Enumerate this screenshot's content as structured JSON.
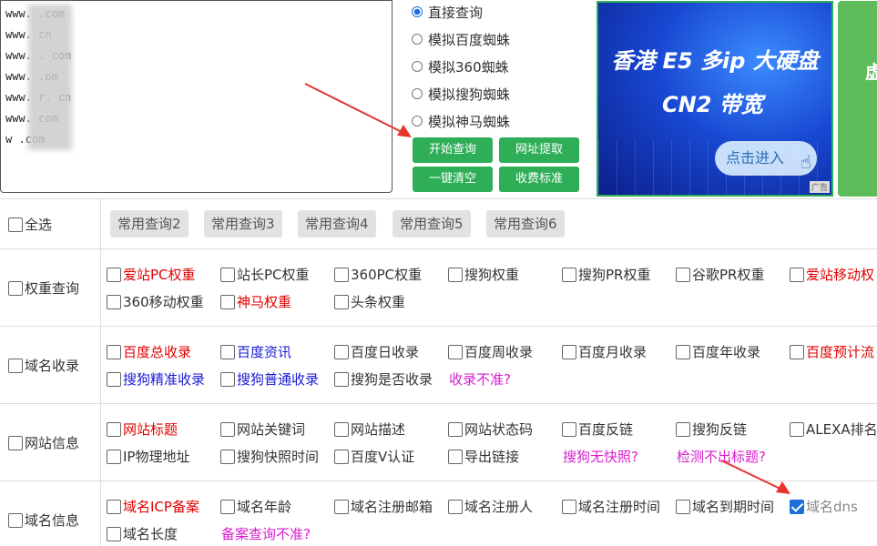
{
  "domains": [
    "www.        .com",
    "www.        cn",
    "www.        . com",
    "www.        .om",
    "www.        r. cn",
    "www.        com",
    "w         .com"
  ],
  "radios": [
    {
      "label": "直接查询",
      "checked": true
    },
    {
      "label": "模拟百度蜘蛛",
      "checked": false
    },
    {
      "label": "模拟360蜘蛛",
      "checked": false
    },
    {
      "label": "模拟搜狗蜘蛛",
      "checked": false
    },
    {
      "label": "模拟神马蜘蛛",
      "checked": false
    }
  ],
  "buttons": {
    "start": "开始查询",
    "extract": "网址提取",
    "clear": "一键清空",
    "pricing": "收费标准"
  },
  "ad": {
    "line1": "香港 E5 多ip  大硬盘",
    "line2": "CN2  带宽",
    "cta": "点击进入",
    "tag": "广告",
    "side_text": "虚"
  },
  "select_all": "全选",
  "common_queries": [
    "常用查询2",
    "常用查询3",
    "常用查询4",
    "常用查询5",
    "常用查询6"
  ],
  "sections": [
    {
      "label": "权重查询",
      "options": [
        {
          "label": "爱站PC权重",
          "color": "red"
        },
        {
          "label": "站长PC权重",
          "color": "dark"
        },
        {
          "label": "360PC权重",
          "color": "dark"
        },
        {
          "label": "搜狗权重",
          "color": "dark"
        },
        {
          "label": "搜狗PR权重",
          "color": "dark"
        },
        {
          "label": "谷歌PR权重",
          "color": "dark"
        },
        {
          "label": "爱站移动权",
          "color": "red"
        },
        {
          "label": "360移动权重",
          "color": "dark"
        },
        {
          "label": "神马权重",
          "color": "red"
        },
        {
          "label": "头条权重",
          "color": "dark"
        }
      ]
    },
    {
      "label": "域名收录",
      "options": [
        {
          "label": "百度总收录",
          "color": "red"
        },
        {
          "label": "百度资讯",
          "color": "blue"
        },
        {
          "label": "百度日收录",
          "color": "dark"
        },
        {
          "label": "百度周收录",
          "color": "dark"
        },
        {
          "label": "百度月收录",
          "color": "dark"
        },
        {
          "label": "百度年收录",
          "color": "dark"
        },
        {
          "label": "百度预计流",
          "color": "red"
        },
        {
          "label": "搜狗精准收录",
          "color": "blue"
        },
        {
          "label": "搜狗普通收录",
          "color": "blue"
        },
        {
          "label": "搜狗是否收录",
          "color": "dark"
        }
      ],
      "note": "收录不准?"
    },
    {
      "label": "网站信息",
      "options": [
        {
          "label": "网站标题",
          "color": "red"
        },
        {
          "label": "网站关键词",
          "color": "dark"
        },
        {
          "label": "网站描述",
          "color": "dark"
        },
        {
          "label": "网站状态码",
          "color": "dark"
        },
        {
          "label": "百度反链",
          "color": "dark"
        },
        {
          "label": "搜狗反链",
          "color": "dark"
        },
        {
          "label": "ALEXA排名",
          "color": "dark"
        },
        {
          "label": "IP物理地址",
          "color": "dark"
        },
        {
          "label": "搜狗快照时间",
          "color": "dark"
        },
        {
          "label": "百度V认证",
          "color": "dark"
        },
        {
          "label": "导出链接",
          "color": "dark"
        }
      ],
      "notes": [
        "搜狗无快照?",
        "检测不出标题?"
      ]
    },
    {
      "label": "域名信息",
      "options": [
        {
          "label": "域名ICP备案",
          "color": "red"
        },
        {
          "label": "域名年龄",
          "color": "dark"
        },
        {
          "label": "域名注册邮箱",
          "color": "dark"
        },
        {
          "label": "域名注册人",
          "color": "dark"
        },
        {
          "label": "域名注册时间",
          "color": "dark"
        },
        {
          "label": "域名到期时间",
          "color": "dark"
        },
        {
          "label": "域名dns",
          "color": "gray",
          "checked": true
        },
        {
          "label": "域名长度",
          "color": "dark"
        }
      ],
      "note": "备案查询不准?"
    }
  ],
  "colors": {
    "green_button": "#2eae57",
    "accent_blue": "#1a6fd8",
    "red_text": "#e00000",
    "blue_text": "#1a1ad6",
    "magenta_text": "#d81ccf",
    "arrow_red": "#e8352b"
  }
}
